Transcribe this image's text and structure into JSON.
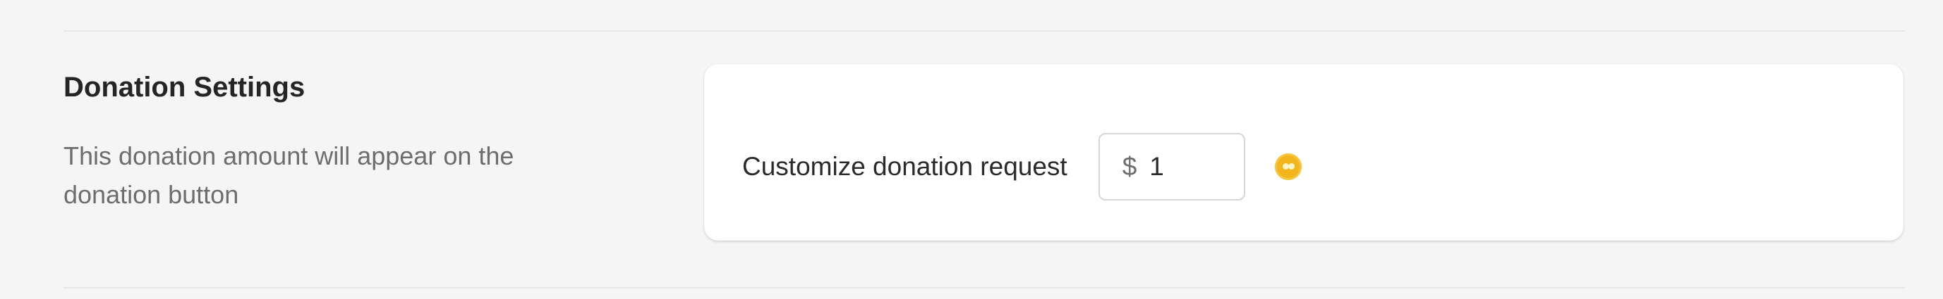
{
  "section": {
    "title": "Donation Settings",
    "description": "This donation amount will appear on the donation button"
  },
  "donation_field": {
    "label": "Customize donation request",
    "currency_symbol": "$",
    "value": "1"
  },
  "icons": {
    "coin": "coin-icon"
  },
  "colors": {
    "background": "#f5f5f5",
    "card": "#ffffff",
    "accent_coin": "#f2b51e"
  }
}
